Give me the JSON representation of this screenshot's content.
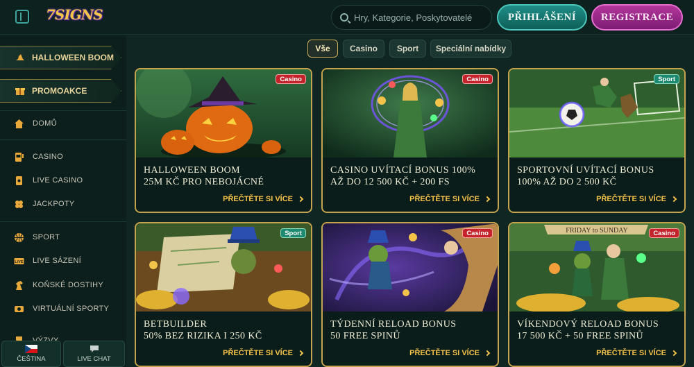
{
  "header": {
    "logo": "7SIGNS",
    "search_placeholder": "Hry, Kategorie, Poskytovatelé",
    "login_label": "PŘIHLÁŠENÍ",
    "register_label": "REGISTRACE"
  },
  "sidebar": {
    "promos": [
      {
        "label": "HALLOWEEN BOOM",
        "icon": "witch-hat-icon"
      },
      {
        "label": "PROMOAKCE",
        "icon": "gift-icon"
      }
    ],
    "items": [
      {
        "label": "DOMŮ",
        "icon": "home-icon"
      },
      {
        "label": "CASINO",
        "icon": "slot-machine-icon"
      },
      {
        "label": "LIVE CASINO",
        "icon": "cards-icon"
      },
      {
        "label": "JACKPOTY",
        "icon": "clover-icon"
      },
      {
        "label": "SPORT",
        "icon": "basketball-icon"
      },
      {
        "label": "LIVE SÁZENÍ",
        "icon": "live-icon"
      },
      {
        "label": "KOŇSKÉ DOSTIHY",
        "icon": "horse-icon"
      },
      {
        "label": "VIRTUÁLNÍ SPORTY",
        "icon": "virtual-sport-icon"
      },
      {
        "label": "VÝZVY",
        "icon": "trophy-icon"
      }
    ],
    "language_label": "ČEŠTINA",
    "live_chat_label": "LIVE CHAT"
  },
  "tabs": [
    "Vše",
    "Casino",
    "Sport",
    "Speciální nabídky"
  ],
  "active_tab": "Vše",
  "cards": [
    {
      "badge": "Casino",
      "title1": "HALLOWEEN BOOM",
      "title2": "25M KČ PRO NEBOJÁCNÉ",
      "cta": "PŘEČTĚTE SI VÍCE"
    },
    {
      "badge": "Casino",
      "title1": "CASINO UVÍTACÍ BONUS 100%",
      "title2": "AŽ DO 12 500 KČ + 200 FS",
      "cta": "PŘEČTĚTE SI VÍCE"
    },
    {
      "badge": "Sport",
      "title1": "SPORTOVNÍ UVÍTACÍ BONUS",
      "title2": "100% AŽ DO 2 500 KČ",
      "cta": "PŘEČTĚTE SI VÍCE"
    },
    {
      "badge": "Sport",
      "title1": "BETBUILDER",
      "title2": "50% BEZ RIZIKA I 250 KČ",
      "cta": "PŘEČTĚTE SI VÍCE"
    },
    {
      "badge": "Casino",
      "title1": "TÝDENNÍ RELOAD BONUS",
      "title2": "50 FREE SPINŮ",
      "cta": "PŘEČTĚTE SI VÍCE"
    },
    {
      "badge": "Casino",
      "title1": "VÍKENDOVÝ RELOAD BONUS",
      "title2": "17 500 KČ + 50 FREE SPINŮ",
      "cta": "PŘEČTĚTE SI VÍCE",
      "banner": "FRIDAY  to  SUNDAY"
    }
  ]
}
